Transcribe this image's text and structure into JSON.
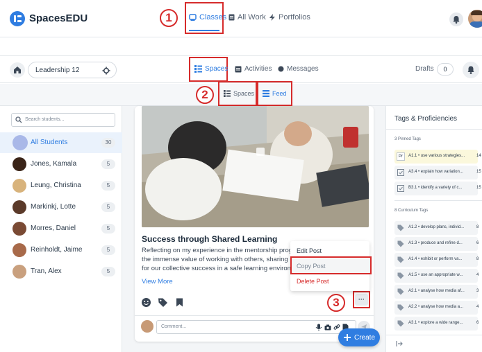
{
  "app": {
    "name": "SpacesEDU"
  },
  "topnav": {
    "classes": "Classes",
    "all_work": "All Work",
    "portfolios": "Portfolios"
  },
  "steps": {
    "one": "1",
    "two": "2",
    "three": "3"
  },
  "class_selector": {
    "name": "Leadership 12"
  },
  "mainnav": {
    "spaces": "Spaces",
    "activities": "Activities",
    "messages": "Messages",
    "drafts_label": "Drafts",
    "drafts_count": "0"
  },
  "subnav": {
    "spaces": "Spaces",
    "feed": "Feed"
  },
  "search": {
    "placeholder": "Search students..."
  },
  "students": [
    {
      "name": "All Students",
      "count": "30"
    },
    {
      "name": "Jones, Kamala",
      "count": "5"
    },
    {
      "name": "Leung, Christina",
      "count": "5"
    },
    {
      "name": "Markinkj, Lotte",
      "count": "5"
    },
    {
      "name": "Morres, Daniel",
      "count": "5"
    },
    {
      "name": "Reinholdt, Jaime",
      "count": "5"
    },
    {
      "name": "Tran, Alex",
      "count": "5"
    }
  ],
  "post": {
    "title": "Success through Shared Learning",
    "line1": "Reflecting on my experience in the mentorship progr",
    "line2": "the immense value of working with others, sharing p",
    "line3": "for our collective success in a safe learning environ",
    "view_more": "View More",
    "more_button": "···",
    "comment_placeholder": "Comment..."
  },
  "context_menu": {
    "edit": "Edit Post",
    "copy": "Copy Post",
    "delete": "Delete Post"
  },
  "create_button": {
    "label": "Create"
  },
  "right_panel": {
    "title": "Tags & Proficiencies",
    "pinned_label": "3 Pinned Tags",
    "pinned": [
      {
        "prefix": "Pr",
        "text": "A1.1 • use various strategies...",
        "count": "14"
      },
      {
        "prefix": "",
        "text": "A3.4 • explain how variation...",
        "count": "15"
      },
      {
        "prefix": "",
        "text": "B3.1 • identify a variety of c...",
        "count": "15"
      }
    ],
    "curriculum_label": "8 Curriculum Tags",
    "curriculum": [
      {
        "text": "A1.2 • develop plans, individ...",
        "count": "8"
      },
      {
        "text": "A1.3 • produce and refine d...",
        "count": "6"
      },
      {
        "text": "A1.4 • exhibit or perform va...",
        "count": "8"
      },
      {
        "text": "A1.5 • use an appropriate w...",
        "count": "4"
      },
      {
        "text": "A2.1 • analyse how media af...",
        "count": "3"
      },
      {
        "text": "A2.2 • analyse how media a...",
        "count": "4"
      },
      {
        "text": "A3.1 • explore a wide range...",
        "count": "6"
      }
    ]
  },
  "colors": {
    "accent": "#2f7de1",
    "annotation": "#d62b2b",
    "danger": "#d62b2b"
  }
}
